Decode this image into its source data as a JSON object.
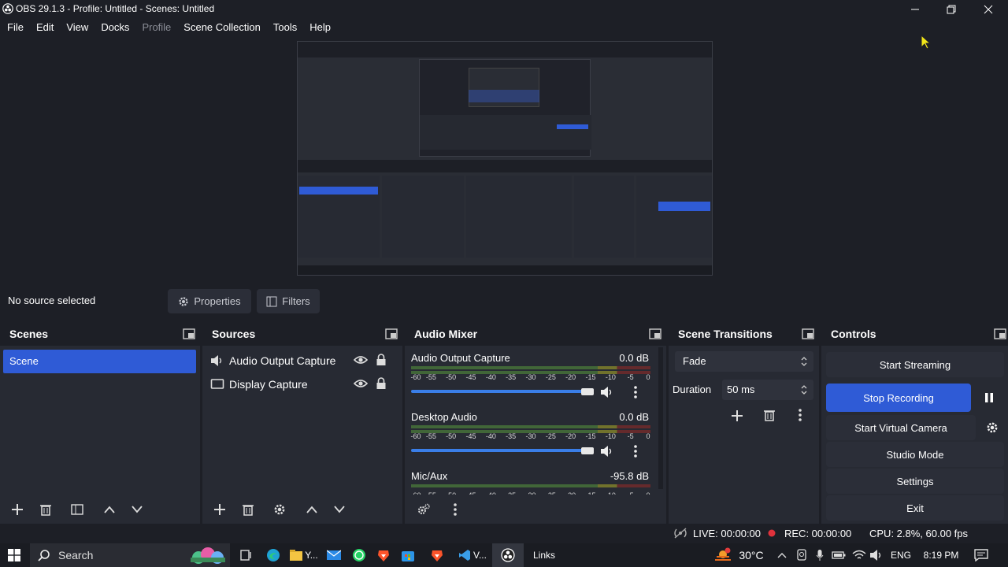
{
  "window": {
    "title": "OBS 29.1.3 - Profile: Untitled - Scenes: Untitled"
  },
  "menu": [
    "File",
    "Edit",
    "View",
    "Docks",
    "Profile",
    "Scene Collection",
    "Tools",
    "Help"
  ],
  "source_bar": {
    "no_source": "No source selected",
    "properties": "Properties",
    "filters": "Filters"
  },
  "scenes": {
    "title": "Scenes",
    "items": [
      "Scene"
    ]
  },
  "sources": {
    "title": "Sources",
    "items": [
      {
        "name": "Audio Output Capture",
        "icon": "speaker-icon"
      },
      {
        "name": "Display Capture",
        "icon": "monitor-icon"
      }
    ]
  },
  "mixer": {
    "title": "Audio Mixer",
    "channels": [
      {
        "name": "Audio Output Capture",
        "db": "0.0 dB",
        "volume": 1.0
      },
      {
        "name": "Desktop Audio",
        "db": "0.0 dB",
        "volume": 1.0
      },
      {
        "name": "Mic/Aux",
        "db": "-95.8 dB",
        "volume": null
      }
    ],
    "scale": [
      "-60",
      "-55",
      "-50",
      "-45",
      "-40",
      "-35",
      "-30",
      "-25",
      "-20",
      "-15",
      "-10",
      "-5",
      "0"
    ]
  },
  "transitions": {
    "title": "Scene Transitions",
    "selected": "Fade",
    "duration_label": "Duration",
    "duration": "50 ms"
  },
  "controls": {
    "title": "Controls",
    "start_streaming": "Start Streaming",
    "stop_recording": "Stop Recording",
    "start_virtual_camera": "Start Virtual Camera",
    "studio_mode": "Studio Mode",
    "settings": "Settings",
    "exit": "Exit"
  },
  "status": {
    "live": "LIVE: 00:00:00",
    "rec": "REC: 00:00:00",
    "cpu": "CPU: 2.8%, 60.00 fps"
  },
  "taskbar": {
    "search": "Search",
    "app1": "Y...",
    "app2": "V...",
    "links": "Links",
    "temp": "30°C",
    "lang": "ENG",
    "time": "8:19 PM"
  },
  "colors": {
    "accent": "#2f5bd6",
    "dock_bg": "#272a33",
    "bg": "#1d1f26",
    "rec_dot": "#e0323c"
  }
}
